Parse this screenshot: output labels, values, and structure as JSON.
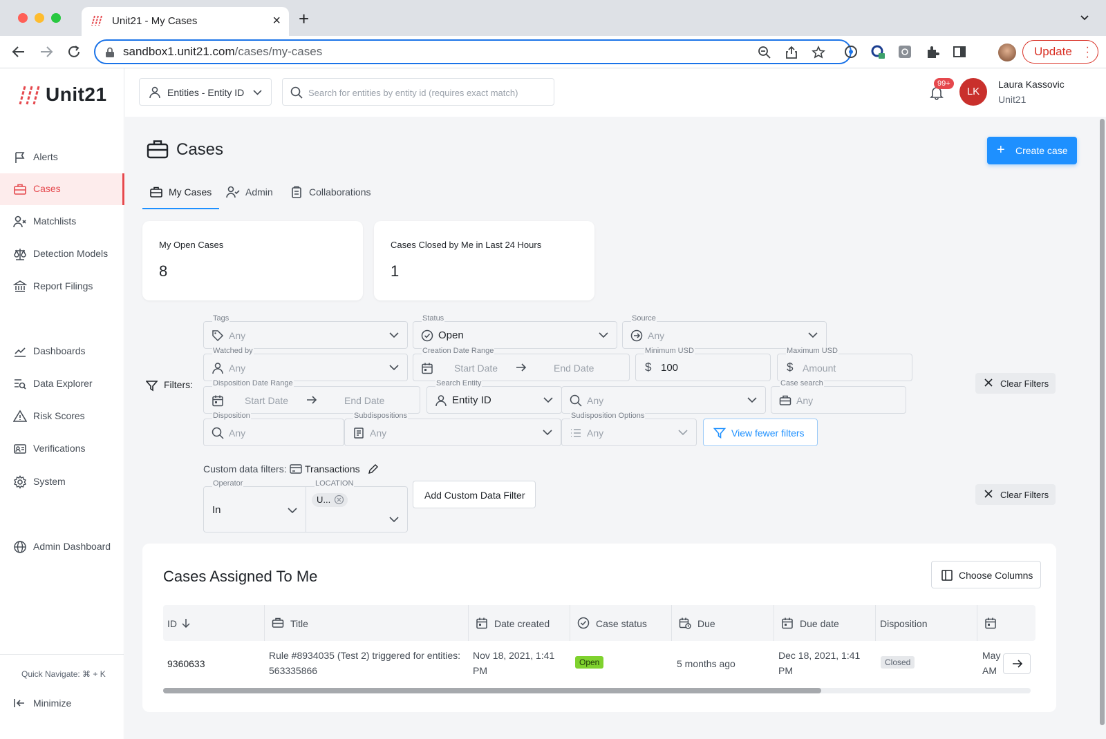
{
  "browser": {
    "tab_title": "Unit21 - My Cases",
    "url_host": "sandbox1.unit21.com",
    "url_path": "/cases/my-cases",
    "update_label": "Update",
    "colors": {
      "close": "#ff5f57",
      "minimize": "#febc2e",
      "maximize": "#28c840"
    }
  },
  "brand": {
    "name": "Unit21",
    "accent": "#e5484d"
  },
  "sidebar": {
    "items": [
      {
        "label": "Alerts",
        "icon": "flag-icon"
      },
      {
        "label": "Cases",
        "icon": "briefcase-icon",
        "active": true
      },
      {
        "label": "Matchlists",
        "icon": "user-x-icon"
      },
      {
        "label": "Detection Models",
        "icon": "scale-icon"
      },
      {
        "label": "Report Filings",
        "icon": "bank-icon"
      },
      {
        "label": "Dashboards",
        "icon": "chart-line-icon"
      },
      {
        "label": "Data Explorer",
        "icon": "table-search-icon"
      },
      {
        "label": "Risk Scores",
        "icon": "warning-icon"
      },
      {
        "label": "Verifications",
        "icon": "id-card-icon"
      },
      {
        "label": "System",
        "icon": "gear-icon"
      },
      {
        "label": "Admin Dashboard",
        "icon": "globe-icon"
      }
    ],
    "quick_navigate": "Quick Navigate: ⌘ + K",
    "minimize": "Minimize"
  },
  "header": {
    "entity_selector": "Entities - Entity ID",
    "search_placeholder": "Search for entities by entity id (requires exact match)",
    "notifications_badge": "99+",
    "user_initials": "LK",
    "user_name": "Laura Kassovic",
    "user_org": "Unit21"
  },
  "page": {
    "title": "Cases",
    "create_button": "Create case",
    "tabs": [
      {
        "label": "My Cases",
        "active": true
      },
      {
        "label": "Admin"
      },
      {
        "label": "Collaborations"
      }
    ],
    "stats": [
      {
        "label": "My Open Cases",
        "value": "8"
      },
      {
        "label": "Cases Closed by Me in Last 24 Hours",
        "value": "1"
      }
    ]
  },
  "filters": {
    "label": "Filters:",
    "tags": {
      "caption": "Tags",
      "value": "Any"
    },
    "status": {
      "caption": "Status",
      "value": "Open"
    },
    "source": {
      "caption": "Source",
      "value": "Any"
    },
    "watched_by": {
      "caption": "Watched by",
      "value": "Any"
    },
    "creation_date_range": {
      "caption": "Creation Date Range",
      "start": "Start Date",
      "end": "End Date"
    },
    "minimum_usd": {
      "caption": "Minimum USD",
      "value": "100"
    },
    "maximum_usd": {
      "caption": "Maximum USD",
      "value": "Amount"
    },
    "disposition_date_range": {
      "caption": "Disposition Date Range",
      "start": "Start Date",
      "end": "End Date"
    },
    "search_entity": {
      "caption": "Search Entity",
      "value": "Entity ID"
    },
    "entity_value": {
      "value": "Any"
    },
    "case_search": {
      "caption": "Case search",
      "value": "Any"
    },
    "disposition": {
      "caption": "Disposition",
      "value": "Any"
    },
    "subdispositions": {
      "caption": "Subdispositions",
      "value": "Any"
    },
    "subdisposition_options": {
      "caption": "Sudisposition Options",
      "value": "Any"
    },
    "view_fewer": "View fewer filters",
    "clear_filters": "Clear Filters",
    "custom": {
      "label": "Custom data filters:",
      "type": "Transactions",
      "operator_caption": "Operator",
      "operator_value": "In",
      "location_caption": "LOCATION",
      "location_chip": "U...",
      "add_button": "Add Custom Data Filter",
      "clear_filters": "Clear Filters"
    }
  },
  "table": {
    "title": "Cases Assigned To Me",
    "choose_columns": "Choose Columns",
    "columns": [
      "ID",
      "Title",
      "Date created",
      "Case status",
      "Due",
      "Due date",
      "Disposition"
    ],
    "rows": [
      {
        "id": "9360633",
        "title_line1": "Rule #8934035 (Test 2) triggered for entities:",
        "title_line2": "563335866",
        "date_created_line1": "Nov 18, 2021, 1:41",
        "date_created_line2": "PM",
        "case_status": "Open",
        "due": "5 months ago",
        "due_date_line1": "Dec 18, 2021, 1:41",
        "due_date_line2": "PM",
        "disposition": "Closed",
        "extra_line1": "May",
        "extra_line2": "AM"
      }
    ],
    "status_colors": {
      "open": "#7fd22e",
      "closed": "#e6e8eb"
    },
    "scroll_fraction": 0.76
  }
}
